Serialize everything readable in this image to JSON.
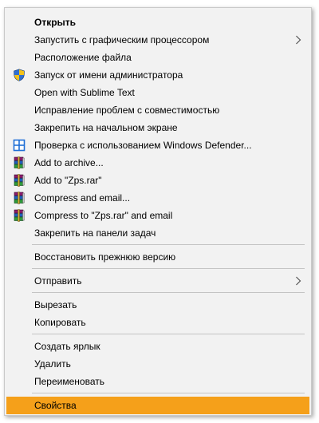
{
  "menu": {
    "items": [
      {
        "label": "Открыть"
      },
      {
        "label": "Запустить с графическим процессором"
      },
      {
        "label": "Расположение файла"
      },
      {
        "label": "Запуск от имени администратора",
        "icon": "uac-shield-icon"
      },
      {
        "label": "Open with Sublime Text"
      },
      {
        "label": "Исправление проблем с совместимостью"
      },
      {
        "label": "Закрепить на начальном экране"
      },
      {
        "label": "Проверка с использованием Windows Defender...",
        "icon": "windows-defender-icon"
      },
      {
        "label": "Add to archive...",
        "icon": "winrar-icon"
      },
      {
        "label": "Add to \"Zps.rar\"",
        "icon": "winrar-icon"
      },
      {
        "label": "Compress and email...",
        "icon": "winrar-icon"
      },
      {
        "label": "Compress to \"Zps.rar\" and email",
        "icon": "winrar-icon"
      },
      {
        "label": "Закрепить на панели задач"
      },
      {
        "label": "Восстановить прежнюю версию"
      },
      {
        "label": "Отправить"
      },
      {
        "label": "Вырезать"
      },
      {
        "label": "Копировать"
      },
      {
        "label": "Создать ярлык"
      },
      {
        "label": "Удалить"
      },
      {
        "label": "Переименовать"
      },
      {
        "label": "Свойства"
      }
    ]
  },
  "colors": {
    "menu_background": "#f2f2f2",
    "highlight": "#f5a01a",
    "separator": "#c4c4c4"
  }
}
